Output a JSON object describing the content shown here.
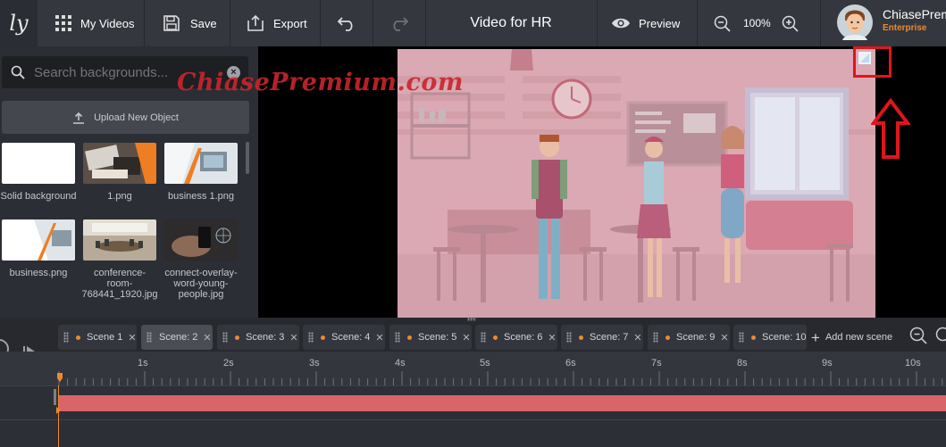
{
  "header": {
    "logo_text": "ly",
    "my_videos_label": "My Videos",
    "save_label": "Save",
    "export_label": "Export",
    "video_title": "Video for HR",
    "preview_label": "Preview",
    "zoom_level": "100%",
    "user_name": "ChiasePrem",
    "user_plan": "Enterprise"
  },
  "sidebar": {
    "search_placeholder": "Search backgrounds...",
    "upload_label": "Upload New Object",
    "items": [
      {
        "label": "Solid background"
      },
      {
        "label": "1.png"
      },
      {
        "label": "business 1.png"
      },
      {
        "label": "business.png"
      },
      {
        "label_lines": [
          "conference-",
          "room-",
          "768441_1920.jpg"
        ]
      },
      {
        "label_lines": [
          "connect-overlay-",
          "word-young-",
          "people.jpg"
        ]
      }
    ]
  },
  "stage": {
    "watermark": "ChiasePremium.com"
  },
  "timeline": {
    "scenes": [
      {
        "label": "Scene 1",
        "active": false
      },
      {
        "label": "Scene: 2",
        "active": true
      },
      {
        "label": "Scene: 3",
        "active": false
      },
      {
        "label": "Scene: 4",
        "active": false
      },
      {
        "label": "Scene: 5",
        "active": false
      },
      {
        "label": "Scene: 6",
        "active": false
      },
      {
        "label": "Scene: 7",
        "active": false
      },
      {
        "label": "Scene: 9",
        "active": false
      },
      {
        "label": "Scene: 10",
        "active": false
      }
    ],
    "add_scene_label": "Add new scene",
    "ruler_labels": [
      "1s",
      "2s",
      "3s",
      "4s",
      "5s",
      "6s",
      "7s",
      "8s",
      "9s",
      "10s"
    ]
  },
  "colors": {
    "accent_orange": "#ee8a2b",
    "annotation_red": "#e0151b",
    "track_bar": "#d9646a",
    "watermark_red": "#c8262c"
  }
}
